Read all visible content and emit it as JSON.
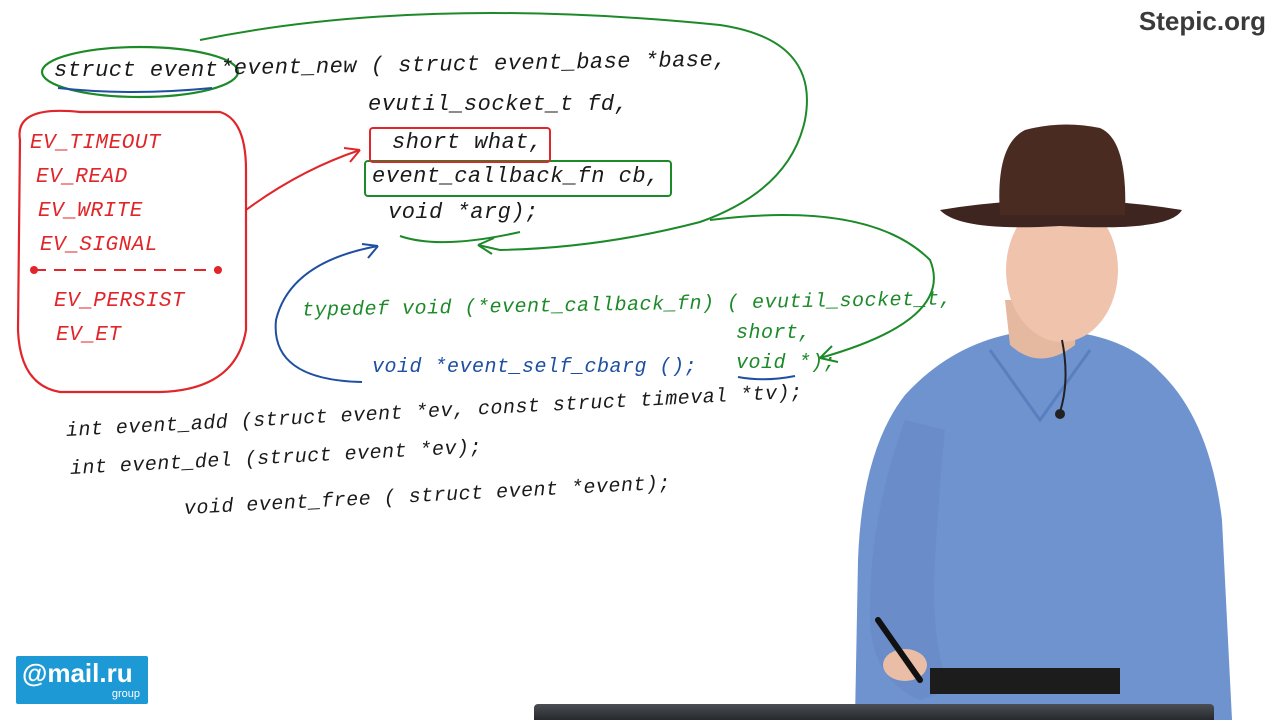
{
  "brand": {
    "text": "Stepic.org"
  },
  "logo": {
    "main": "@mail.ru",
    "sub": "group"
  },
  "code": {
    "line1_type": "struct event",
    "line1_rest": "*event_new ( struct event_base *base,",
    "line2": "evutil_socket_t fd,",
    "line3": "short what,",
    "line4": "event_callback_fn cb,",
    "line5": "void *arg);",
    "typedef_a": "typedef void (*event_callback_fn) ( evutil_socket_t,",
    "typedef_b": "short,",
    "typedef_c": "void *);",
    "self_cbarg": "void *event_self_cbarg ();",
    "add": "int event_add (struct event *ev, const struct timeval *tv);",
    "del": "int event_del (struct event *ev);",
    "free": "void event_free ( struct event *event);"
  },
  "flags": {
    "primary": [
      "EV_TIMEOUT",
      "EV_READ",
      "EV_WRITE",
      "EV_SIGNAL"
    ],
    "secondary": [
      "EV_PERSIST",
      "EV_ET"
    ]
  },
  "colors": {
    "black": "#1a1a1a",
    "green": "#1d8a2a",
    "red": "#e0262a",
    "blue": "#1e4fa0",
    "shirt": "#6f93cf",
    "hat": "#4a2b22"
  }
}
